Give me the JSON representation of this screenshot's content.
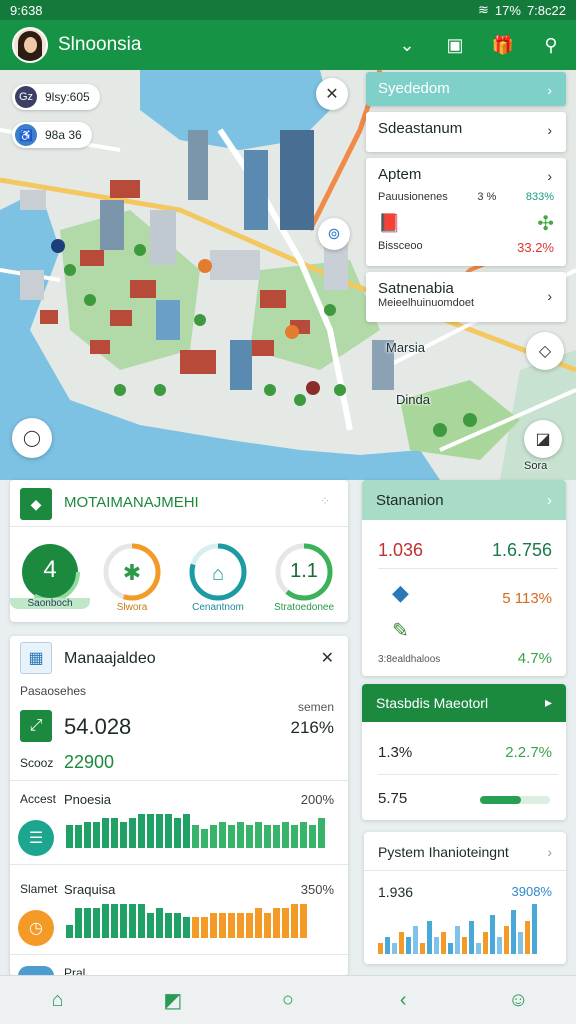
{
  "status": {
    "time": "9:638",
    "battery": "17%",
    "clock": "7:8c22"
  },
  "app": {
    "title": "Slnoonsia"
  },
  "map": {
    "pill1": {
      "badge": "Gz",
      "text": "9lsy:605"
    },
    "pill2": {
      "text": "98a 36"
    },
    "label_marsia": "Marsia",
    "label_dinda": "Dinda",
    "label_sora": "Sora"
  },
  "cards": {
    "head": "Syededom",
    "c1": "Sdeastanum",
    "c2": {
      "title": "Aptem",
      "label": "Pauusionenes",
      "pct1": "3 %",
      "pct2": "833%",
      "sub": "Bissceoo",
      "val": "33.2%"
    },
    "c3": {
      "title": "Satnenabia",
      "sub": "Meieelhuinuomdoet"
    }
  },
  "mgmt": {
    "title": "MOTAIMANAJMEHI",
    "gauges": [
      {
        "value": "4",
        "label": "Saonboch"
      },
      {
        "label": "Slwora"
      },
      {
        "label": "Cenantnom"
      },
      {
        "value": "1.1",
        "label": "Stratoedonee"
      }
    ]
  },
  "stat": {
    "title": "Stananion",
    "v1": "1.036",
    "v2": "1.6.756",
    "v3": "5 113%",
    "sub": "3:8ealdhaloos",
    "v4": "4.7%"
  },
  "manage": {
    "title": "Manaajaldeo",
    "sub": "Pasaosehes",
    "big": "54.028",
    "sem": "semen",
    "pct": "216%",
    "scoot": "Scooz",
    "green": "22900",
    "rows": [
      {
        "k": "Accest",
        "n": "Pnoesia",
        "v": "200%"
      },
      {
        "k": "Slamet",
        "n": "Sraquisa",
        "v": "350%"
      }
    ],
    "bottom": "Pral"
  },
  "meter": {
    "title": "Stasbdis Maeotorl",
    "v1": "1.3%",
    "v2": "2.2.7%",
    "v3": "5.75"
  },
  "pyst": {
    "title": "Pystem Ihanioteingnt",
    "v1": "1.936",
    "v2": "3908%"
  },
  "chart_data": [
    {
      "type": "bar",
      "title": "Pnoesia",
      "values": [
        6,
        6,
        7,
        7,
        8,
        8,
        7,
        8,
        9,
        9,
        9,
        9,
        8,
        9,
        6,
        5,
        6,
        7,
        6,
        7,
        6,
        7,
        6,
        6,
        7,
        6,
        7,
        6,
        8
      ]
    },
    {
      "type": "bar",
      "title": "Sraquisa",
      "values": [
        3,
        7,
        7,
        7,
        8,
        8,
        8,
        8,
        8,
        6,
        7,
        6,
        6,
        5,
        5,
        5,
        6,
        6,
        6,
        6,
        6,
        7,
        6,
        7,
        7,
        8,
        8
      ]
    },
    {
      "type": "bar",
      "title": "Pystem Ihanioteingnt",
      "values": [
        2,
        3,
        2,
        4,
        3,
        5,
        2,
        6,
        3,
        4,
        2,
        5,
        3,
        6,
        2,
        4,
        7,
        3,
        5,
        8,
        4,
        6,
        9
      ]
    }
  ]
}
